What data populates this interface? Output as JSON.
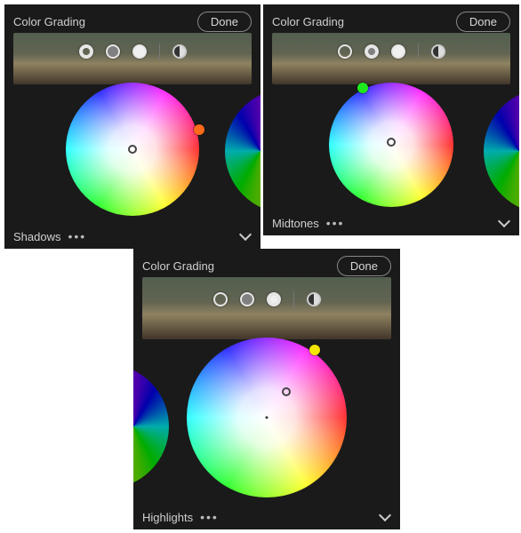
{
  "panels": {
    "shadows": {
      "title": "Color Grading",
      "done": "Done",
      "footer": "Shadows",
      "selected_tone": "shadows",
      "hue_handle_color": "#ff6a1a",
      "hue_handle_pos": {
        "left_pct": 100,
        "top_pct": 35
      },
      "inner_handle_pos": {
        "left_pct": 50,
        "top_pct": 50
      }
    },
    "midtones": {
      "title": "Color Grading",
      "done": "Done",
      "footer": "Midtones",
      "selected_tone": "midtones",
      "hue_handle_color": "#1ee81e",
      "hue_handle_pos": {
        "left_pct": 27,
        "top_pct": 4
      },
      "inner_handle_pos": {
        "left_pct": 50,
        "top_pct": 48
      }
    },
    "highlights": {
      "title": "Color Grading",
      "done": "Done",
      "footer": "Highlights",
      "selected_tone": "highlights",
      "hue_handle_color": "#f4e400",
      "hue_handle_pos": {
        "left_pct": 80,
        "top_pct": 8
      },
      "inner_handle_pos": {
        "left_pct": 62,
        "top_pct": 34
      },
      "center_dot": true
    }
  },
  "tones": {
    "shadows_label": "Shadows",
    "midtones_label": "Midtones",
    "highlights_label": "Highlights",
    "global_label": "Global"
  }
}
